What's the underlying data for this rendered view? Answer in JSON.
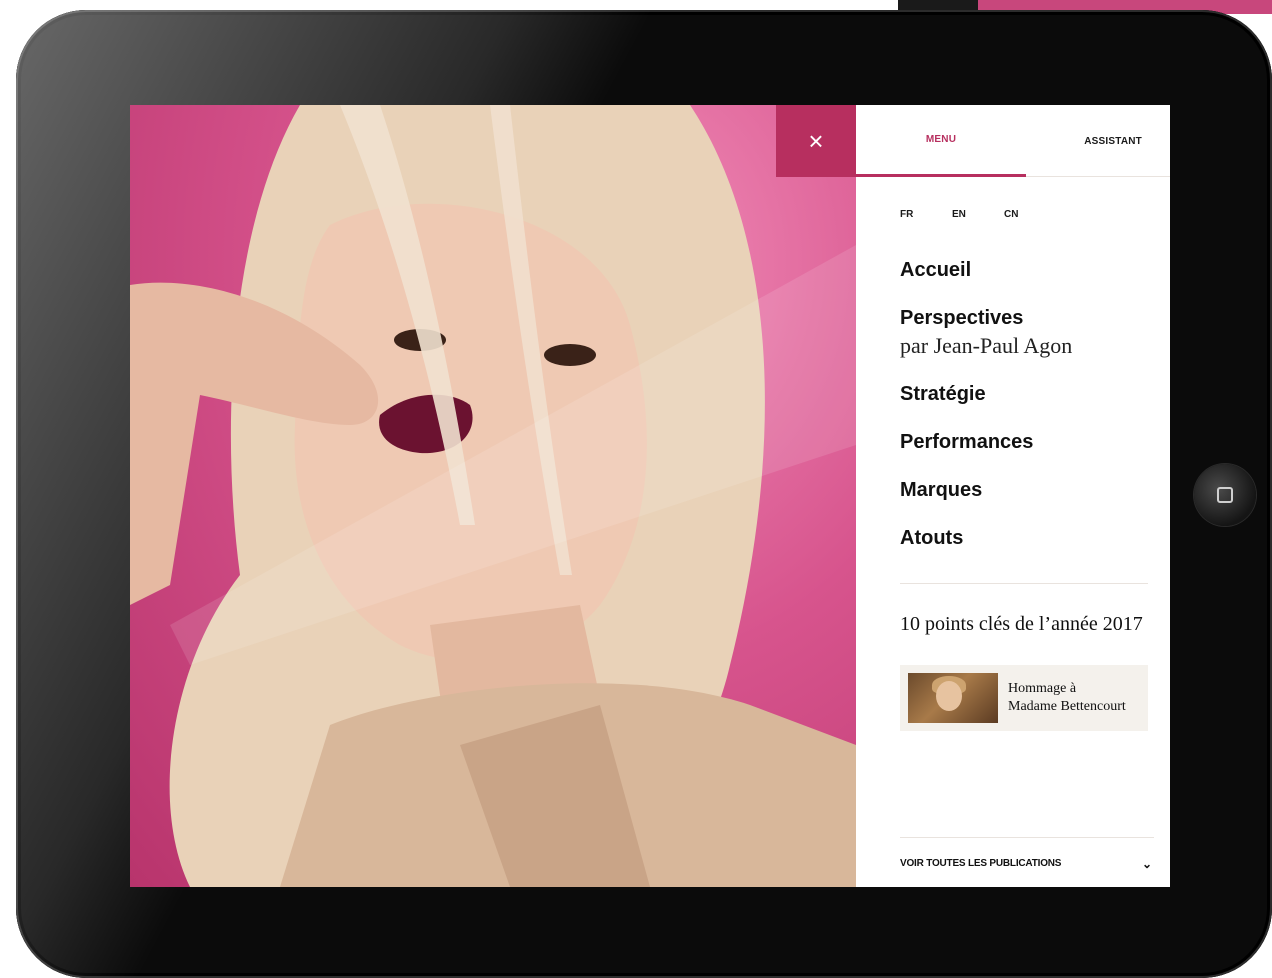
{
  "panel": {
    "close_icon": "×",
    "tabs": [
      {
        "label": "MENU",
        "active": true
      },
      {
        "label": "ASSISTANT",
        "active": false
      }
    ],
    "languages": [
      "FR",
      "EN",
      "CN"
    ],
    "nav": {
      "items": [
        {
          "label": "Accueil"
        },
        {
          "label": "Perspectives",
          "sub": "par Jean-Paul Agon"
        },
        {
          "label": "Stratégie"
        },
        {
          "label": "Performances"
        },
        {
          "label": "Marques"
        },
        {
          "label": "Atouts"
        }
      ]
    },
    "key_points": "10 points clés de l’année 2017",
    "tribute": {
      "line1": "Hommage à",
      "line2": "Madame Bettencourt"
    },
    "publications": {
      "label": "VOIR TOUTES LES PUBLICATIONS",
      "chevron": "⌄"
    }
  },
  "colors": {
    "accent": "#b72f5f",
    "hero_pink": "#d7548d",
    "device": "#0b0b0b",
    "panel_bg": "#ffffff",
    "card_bg": "#f4f1ec"
  },
  "icons": {
    "close": "close-icon",
    "chevron": "chevron-down-icon",
    "home": "home-button-icon"
  }
}
